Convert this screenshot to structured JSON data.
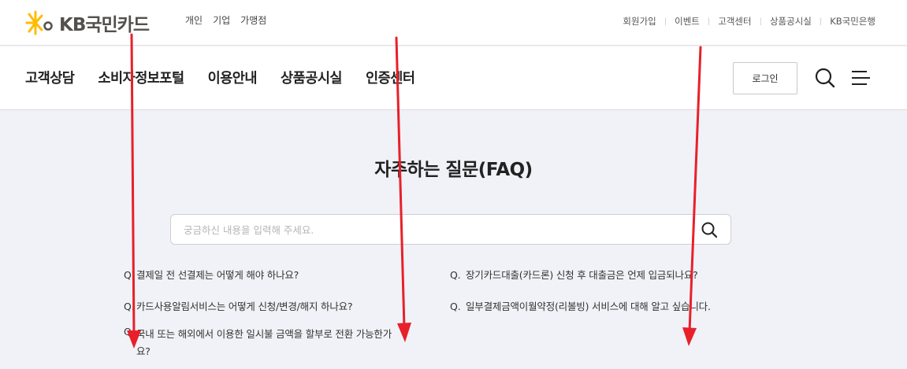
{
  "header": {
    "logo_text": "KB국민카드",
    "segments": [
      "개인",
      "기업",
      "가맹점"
    ],
    "util_links": [
      "회원가입",
      "이벤트",
      "고객센터",
      "상품공시실",
      "KB국민은행"
    ]
  },
  "gnb": {
    "menu": [
      "고객상담",
      "소비자정보포털",
      "이용안내",
      "상품공시실",
      "인증센터"
    ],
    "login_label": "로그인"
  },
  "page": {
    "title": "자주하는 질문(FAQ)",
    "search_placeholder": "궁금하신 내용을 입력해 주세요."
  },
  "faq": {
    "prefix": "Q.",
    "left": [
      "결제일 전 선결제는 어떻게 해야 하나요?",
      "카드사용알림서비스는 어떻게 신청/변경/해지 하나요?",
      "국내 또는 해외에서 이용한 일시불 금액을 할부로 전환 가능한가요?"
    ],
    "right": [
      "장기카드대출(카드론) 신청 후 대출금은 언제 입금되나요?",
      "일부결제금액이월약정(리볼빙) 서비스에 대해 알고 싶습니다."
    ]
  },
  "colors": {
    "brand_yellow": "#ffbc00",
    "brand_gray": "#54504b",
    "annotation_red": "#e8202a",
    "page_bg": "#f0f2f7"
  },
  "icons": [
    "kb-star-logo-icon",
    "search-icon",
    "menu-icon"
  ]
}
